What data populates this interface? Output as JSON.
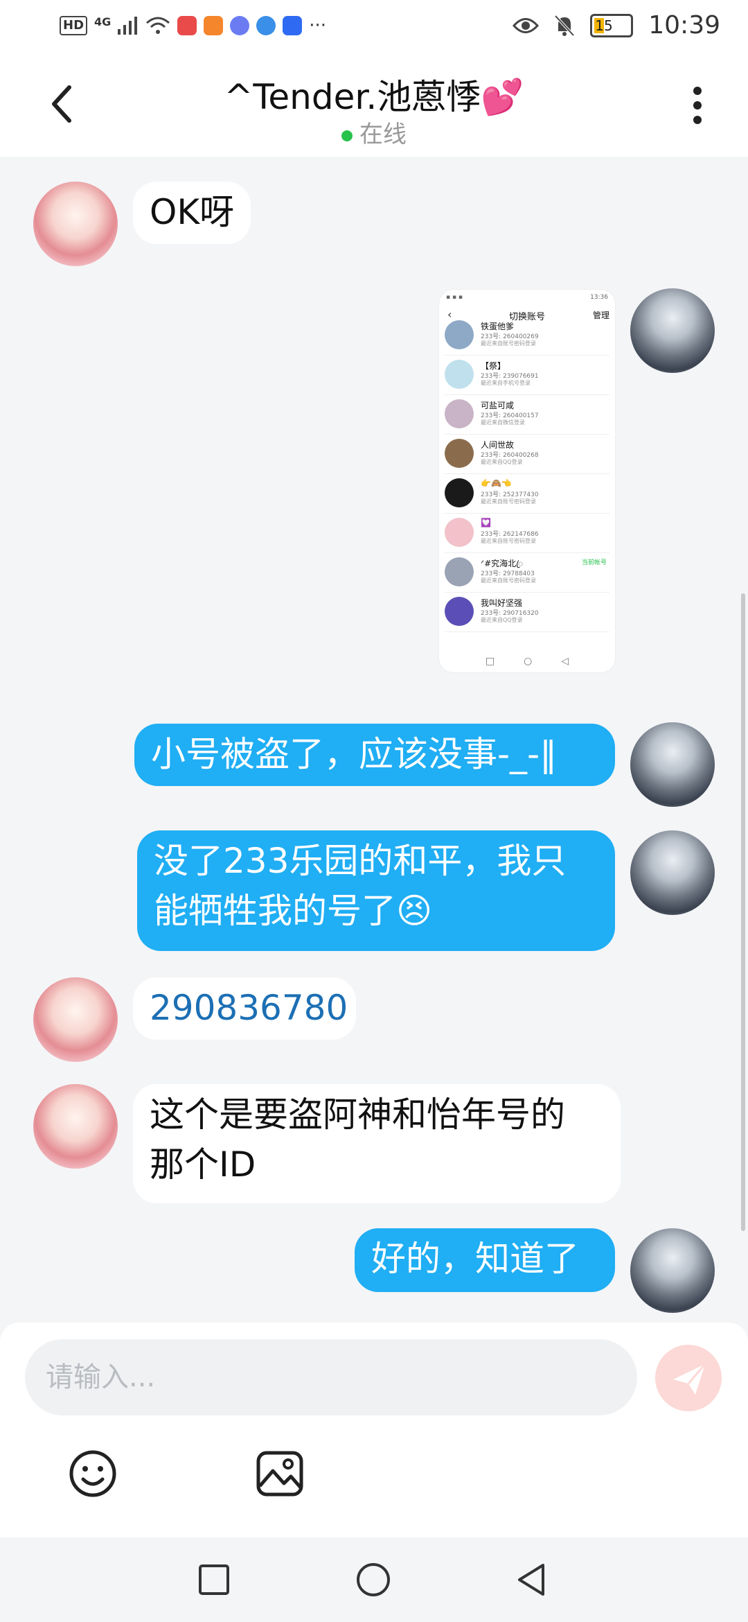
{
  "status_bar": {
    "hd_label": "HD",
    "network": "4G",
    "time": "10:39",
    "battery": "15",
    "more": "···"
  },
  "header": {
    "title": "^Tender.池蒽悸💕",
    "status": "在线"
  },
  "messages": [
    {
      "side": "left",
      "text": "OK呀"
    },
    {
      "side": "right",
      "type": "image"
    },
    {
      "side": "right",
      "text": "小号被盗了，应该没事-_-‖"
    },
    {
      "side": "right",
      "line1": "没了233乐园的和平，我只",
      "line2": "能牺牲我的号了😣"
    },
    {
      "side": "left",
      "text": "290836780"
    },
    {
      "side": "left",
      "line1": "这个是要盗阿神和怡年号的",
      "line2": "那个ID"
    },
    {
      "side": "right",
      "text": "好的，知道了"
    }
  ],
  "shared_screenshot": {
    "status_time": "13:36",
    "title": "切换账号",
    "manage": "管理",
    "accounts": [
      {
        "name": "铁蛋他爹",
        "id": "233号: 260400269",
        "login": "最近来自账号密码登录",
        "color": "#8ea9c6"
      },
      {
        "name": "【祭】",
        "id": "233号: 239076691",
        "login": "最近来自手机号登录",
        "color": "#bfe0ec"
      },
      {
        "name": "可盐可咸",
        "id": "233号: 260400157",
        "login": "最近来自微信登录",
        "color": "#c9b3c6"
      },
      {
        "name": "人间世故",
        "id": "233号: 260400268",
        "login": "最近来自QQ登录",
        "color": "#8a6c4c"
      },
      {
        "name": "👉🙈👈",
        "id": "233号: 252377430",
        "login": "最近来自账号密码登录",
        "color": "#1a1a1a"
      },
      {
        "name": "💟",
        "id": "233号: 262147686",
        "login": "最近来自账号密码登录",
        "color": "#f2c1c9"
      },
      {
        "name": "ᐟ#究海北ꦿ",
        "id": "233号: 29788403",
        "login": "最近来自账号密码登录",
        "color": "#9aa3b4",
        "current": "当前帐号"
      },
      {
        "name": "我叫好坚强",
        "id": "233号: 290716320",
        "login": "最近来自QQ登录",
        "color": "#5b4fb7"
      }
    ]
  },
  "composer": {
    "placeholder": "请输入..."
  },
  "icons": {
    "back": "back-arrow-icon",
    "more": "more-vertical-icon",
    "emoji": "emoji-icon",
    "image": "image-icon",
    "send": "send-icon",
    "nav_recent": "square-icon",
    "nav_home": "circle-icon",
    "nav_back": "triangle-back-icon"
  },
  "colors": {
    "bubble_blue": "#20aef4",
    "online_green": "#27c24c",
    "link_blue": "#1c6fb4"
  }
}
